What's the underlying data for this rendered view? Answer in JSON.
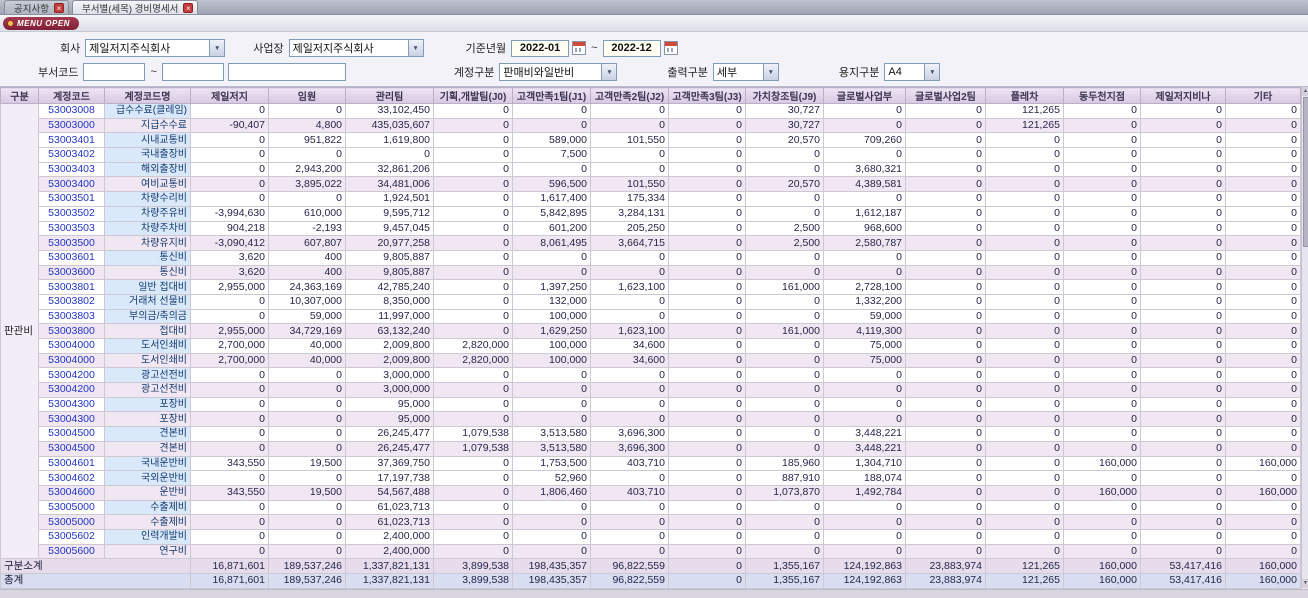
{
  "tabs": [
    {
      "label": "공지사항"
    },
    {
      "label": "부서별(세목) 경비명세서"
    }
  ],
  "icons": {
    "close": "×",
    "chevron_down": "▼",
    "scroll_up": "▲",
    "scroll_down": "▼"
  },
  "menu_open_label": "MENU OPEN",
  "filters": {
    "company_label": "회사",
    "company_value": "제일저지주식회사",
    "workplace_label": "사업장",
    "workplace_value": "제일저지주식회사",
    "period_label": "기준년월",
    "period_from": "2022-01",
    "period_to": "2022-12",
    "tilde": "~",
    "dept_code_label": "부서코드",
    "dept_from": "",
    "dept_to": "",
    "dept_name": "",
    "account_type_label": "계정구분",
    "account_type_value": "판매비와일반비",
    "output_type_label": "출력구분",
    "output_type_value": "세부",
    "paper_type_label": "용지구분",
    "paper_type_value": "A4"
  },
  "colors": {
    "accent_maroon": "#8B2339",
    "header_purple": "#DCCDE6",
    "subtotal_row_bg": "#F1E7F2",
    "detail_name_bg": "#D9E9FA",
    "code_text_blue": "#2134C9",
    "total_row_bg": "#D8DDF0"
  },
  "table": {
    "group_label": "판관비",
    "columns": [
      "구분",
      "계정코드",
      "계정코드명",
      "제일저지",
      "임원",
      "관리팀",
      "기획,개발팀(J0)",
      "고객만족1팀(J1)",
      "고객만족2팀(J2)",
      "고객만족3팀(J3)",
      "가치창조팀(J9)",
      "글로벌사업부",
      "글로벌사업2팀",
      "플레차",
      "동두천지점",
      "제일저지비나",
      "기타"
    ],
    "rows": [
      {
        "code": "53003008",
        "name": "급수수료(클레임)",
        "subtotal": false,
        "values": [
          "0",
          "0",
          "33,102,450",
          "0",
          "0",
          "0",
          "0",
          "30,727",
          "0",
          "0",
          "121,265",
          "0",
          "0",
          "0"
        ]
      },
      {
        "code": "53003000",
        "name": "지급수수료",
        "subtotal": true,
        "values": [
          "-90,407",
          "4,800",
          "435,035,607",
          "0",
          "0",
          "0",
          "0",
          "30,727",
          "0",
          "0",
          "121,265",
          "0",
          "0",
          "0"
        ]
      },
      {
        "code": "53003401",
        "name": "시내교통비",
        "subtotal": false,
        "values": [
          "0",
          "951,822",
          "1,619,800",
          "0",
          "589,000",
          "101,550",
          "0",
          "20,570",
          "709,260",
          "0",
          "0",
          "0",
          "0",
          "0"
        ]
      },
      {
        "code": "53003402",
        "name": "국내출장비",
        "subtotal": false,
        "values": [
          "0",
          "0",
          "0",
          "0",
          "7,500",
          "0",
          "0",
          "0",
          "0",
          "0",
          "0",
          "0",
          "0",
          "0"
        ]
      },
      {
        "code": "53003403",
        "name": "해외출장비",
        "subtotal": false,
        "values": [
          "0",
          "2,943,200",
          "32,861,206",
          "0",
          "0",
          "0",
          "0",
          "0",
          "3,680,321",
          "0",
          "0",
          "0",
          "0",
          "0"
        ]
      },
      {
        "code": "53003400",
        "name": "여비교통비",
        "subtotal": true,
        "values": [
          "0",
          "3,895,022",
          "34,481,006",
          "0",
          "596,500",
          "101,550",
          "0",
          "20,570",
          "4,389,581",
          "0",
          "0",
          "0",
          "0",
          "0"
        ]
      },
      {
        "code": "53003501",
        "name": "차량수리비",
        "subtotal": false,
        "values": [
          "0",
          "0",
          "1,924,501",
          "0",
          "1,617,400",
          "175,334",
          "0",
          "0",
          "0",
          "0",
          "0",
          "0",
          "0",
          "0"
        ]
      },
      {
        "code": "53003502",
        "name": "차량주유비",
        "subtotal": false,
        "values": [
          "-3,994,630",
          "610,000",
          "9,595,712",
          "0",
          "5,842,895",
          "3,284,131",
          "0",
          "0",
          "1,612,187",
          "0",
          "0",
          "0",
          "0",
          "0"
        ]
      },
      {
        "code": "53003503",
        "name": "차량주차비",
        "subtotal": false,
        "values": [
          "904,218",
          "-2,193",
          "9,457,045",
          "0",
          "601,200",
          "205,250",
          "0",
          "2,500",
          "968,600",
          "0",
          "0",
          "0",
          "0",
          "0"
        ]
      },
      {
        "code": "53003500",
        "name": "차량유지비",
        "subtotal": true,
        "values": [
          "-3,090,412",
          "607,807",
          "20,977,258",
          "0",
          "8,061,495",
          "3,664,715",
          "0",
          "2,500",
          "2,580,787",
          "0",
          "0",
          "0",
          "0",
          "0"
        ]
      },
      {
        "code": "53003601",
        "name": "통신비",
        "subtotal": false,
        "values": [
          "3,620",
          "400",
          "9,805,887",
          "0",
          "0",
          "0",
          "0",
          "0",
          "0",
          "0",
          "0",
          "0",
          "0",
          "0"
        ]
      },
      {
        "code": "53003600",
        "name": "통신비",
        "subtotal": true,
        "values": [
          "3,620",
          "400",
          "9,805,887",
          "0",
          "0",
          "0",
          "0",
          "0",
          "0",
          "0",
          "0",
          "0",
          "0",
          "0"
        ]
      },
      {
        "code": "53003801",
        "name": "일반 접대비",
        "subtotal": false,
        "values": [
          "2,955,000",
          "24,363,169",
          "42,785,240",
          "0",
          "1,397,250",
          "1,623,100",
          "0",
          "161,000",
          "2,728,100",
          "0",
          "0",
          "0",
          "0",
          "0"
        ]
      },
      {
        "code": "53003802",
        "name": "거래처 선물비",
        "subtotal": false,
        "values": [
          "0",
          "10,307,000",
          "8,350,000",
          "0",
          "132,000",
          "0",
          "0",
          "0",
          "1,332,200",
          "0",
          "0",
          "0",
          "0",
          "0"
        ]
      },
      {
        "code": "53003803",
        "name": "부의금/축의금",
        "subtotal": false,
        "values": [
          "0",
          "59,000",
          "11,997,000",
          "0",
          "100,000",
          "0",
          "0",
          "0",
          "59,000",
          "0",
          "0",
          "0",
          "0",
          "0"
        ]
      },
      {
        "code": "53003800",
        "name": "접대비",
        "subtotal": true,
        "values": [
          "2,955,000",
          "34,729,169",
          "63,132,240",
          "0",
          "1,629,250",
          "1,623,100",
          "0",
          "161,000",
          "4,119,300",
          "0",
          "0",
          "0",
          "0",
          "0"
        ]
      },
      {
        "code": "53004000",
        "name": "도서인쇄비",
        "subtotal": false,
        "values": [
          "2,700,000",
          "40,000",
          "2,009,800",
          "2,820,000",
          "100,000",
          "34,600",
          "0",
          "0",
          "75,000",
          "0",
          "0",
          "0",
          "0",
          "0"
        ]
      },
      {
        "code": "53004000",
        "name": "도서인쇄비",
        "subtotal": true,
        "values": [
          "2,700,000",
          "40,000",
          "2,009,800",
          "2,820,000",
          "100,000",
          "34,600",
          "0",
          "0",
          "75,000",
          "0",
          "0",
          "0",
          "0",
          "0"
        ]
      },
      {
        "code": "53004200",
        "name": "광고선전비",
        "subtotal": false,
        "values": [
          "0",
          "0",
          "3,000,000",
          "0",
          "0",
          "0",
          "0",
          "0",
          "0",
          "0",
          "0",
          "0",
          "0",
          "0"
        ]
      },
      {
        "code": "53004200",
        "name": "광고선전비",
        "subtotal": true,
        "values": [
          "0",
          "0",
          "3,000,000",
          "0",
          "0",
          "0",
          "0",
          "0",
          "0",
          "0",
          "0",
          "0",
          "0",
          "0"
        ]
      },
      {
        "code": "53004300",
        "name": "포장비",
        "subtotal": false,
        "values": [
          "0",
          "0",
          "95,000",
          "0",
          "0",
          "0",
          "0",
          "0",
          "0",
          "0",
          "0",
          "0",
          "0",
          "0"
        ]
      },
      {
        "code": "53004300",
        "name": "포장비",
        "subtotal": true,
        "values": [
          "0",
          "0",
          "95,000",
          "0",
          "0",
          "0",
          "0",
          "0",
          "0",
          "0",
          "0",
          "0",
          "0",
          "0"
        ]
      },
      {
        "code": "53004500",
        "name": "견본비",
        "subtotal": false,
        "values": [
          "0",
          "0",
          "26,245,477",
          "1,079,538",
          "3,513,580",
          "3,696,300",
          "0",
          "0",
          "3,448,221",
          "0",
          "0",
          "0",
          "0",
          "0"
        ]
      },
      {
        "code": "53004500",
        "name": "견본비",
        "subtotal": true,
        "values": [
          "0",
          "0",
          "26,245,477",
          "1,079,538",
          "3,513,580",
          "3,696,300",
          "0",
          "0",
          "3,448,221",
          "0",
          "0",
          "0",
          "0",
          "0"
        ]
      },
      {
        "code": "53004601",
        "name": "국내운반비",
        "subtotal": false,
        "values": [
          "343,550",
          "19,500",
          "37,369,750",
          "0",
          "1,753,500",
          "403,710",
          "0",
          "185,960",
          "1,304,710",
          "0",
          "0",
          "160,000",
          "0",
          "160,000"
        ]
      },
      {
        "code": "53004602",
        "name": "국외운반비",
        "subtotal": false,
        "values": [
          "0",
          "0",
          "17,197,738",
          "0",
          "52,960",
          "0",
          "0",
          "887,910",
          "188,074",
          "0",
          "0",
          "0",
          "0",
          "0"
        ]
      },
      {
        "code": "53004600",
        "name": "운반비",
        "subtotal": true,
        "values": [
          "343,550",
          "19,500",
          "54,567,488",
          "0",
          "1,806,460",
          "403,710",
          "0",
          "1,073,870",
          "1,492,784",
          "0",
          "0",
          "160,000",
          "0",
          "160,000"
        ]
      },
      {
        "code": "53005000",
        "name": "수출제비",
        "subtotal": false,
        "values": [
          "0",
          "0",
          "61,023,713",
          "0",
          "0",
          "0",
          "0",
          "0",
          "0",
          "0",
          "0",
          "0",
          "0",
          "0"
        ]
      },
      {
        "code": "53005000",
        "name": "수출제비",
        "subtotal": true,
        "values": [
          "0",
          "0",
          "61,023,713",
          "0",
          "0",
          "0",
          "0",
          "0",
          "0",
          "0",
          "0",
          "0",
          "0",
          "0"
        ]
      },
      {
        "code": "53005602",
        "name": "인력개발비",
        "subtotal": false,
        "values": [
          "0",
          "0",
          "2,400,000",
          "0",
          "0",
          "0",
          "0",
          "0",
          "0",
          "0",
          "0",
          "0",
          "0",
          "0"
        ]
      },
      {
        "code": "53005600",
        "name": "연구비",
        "subtotal": true,
        "values": [
          "0",
          "0",
          "2,400,000",
          "0",
          "0",
          "0",
          "0",
          "0",
          "0",
          "0",
          "0",
          "0",
          "0",
          "0"
        ]
      }
    ],
    "subtotal_row": {
      "label": "구분소계",
      "values": [
        "16,871,601",
        "189,537,246",
        "1,337,821,131",
        "3,899,538",
        "198,435,357",
        "96,822,559",
        "0",
        "1,355,167",
        "124,192,863",
        "23,883,974",
        "121,265",
        "160,000",
        "53,417,416",
        "160,000"
      ]
    },
    "total_row": {
      "label": "총계",
      "values": [
        "16,871,601",
        "189,537,246",
        "1,337,821,131",
        "3,899,538",
        "198,435,357",
        "96,822,559",
        "0",
        "1,355,167",
        "124,192,863",
        "23,883,974",
        "121,265",
        "160,000",
        "53,417,416",
        "160,000"
      ]
    }
  }
}
